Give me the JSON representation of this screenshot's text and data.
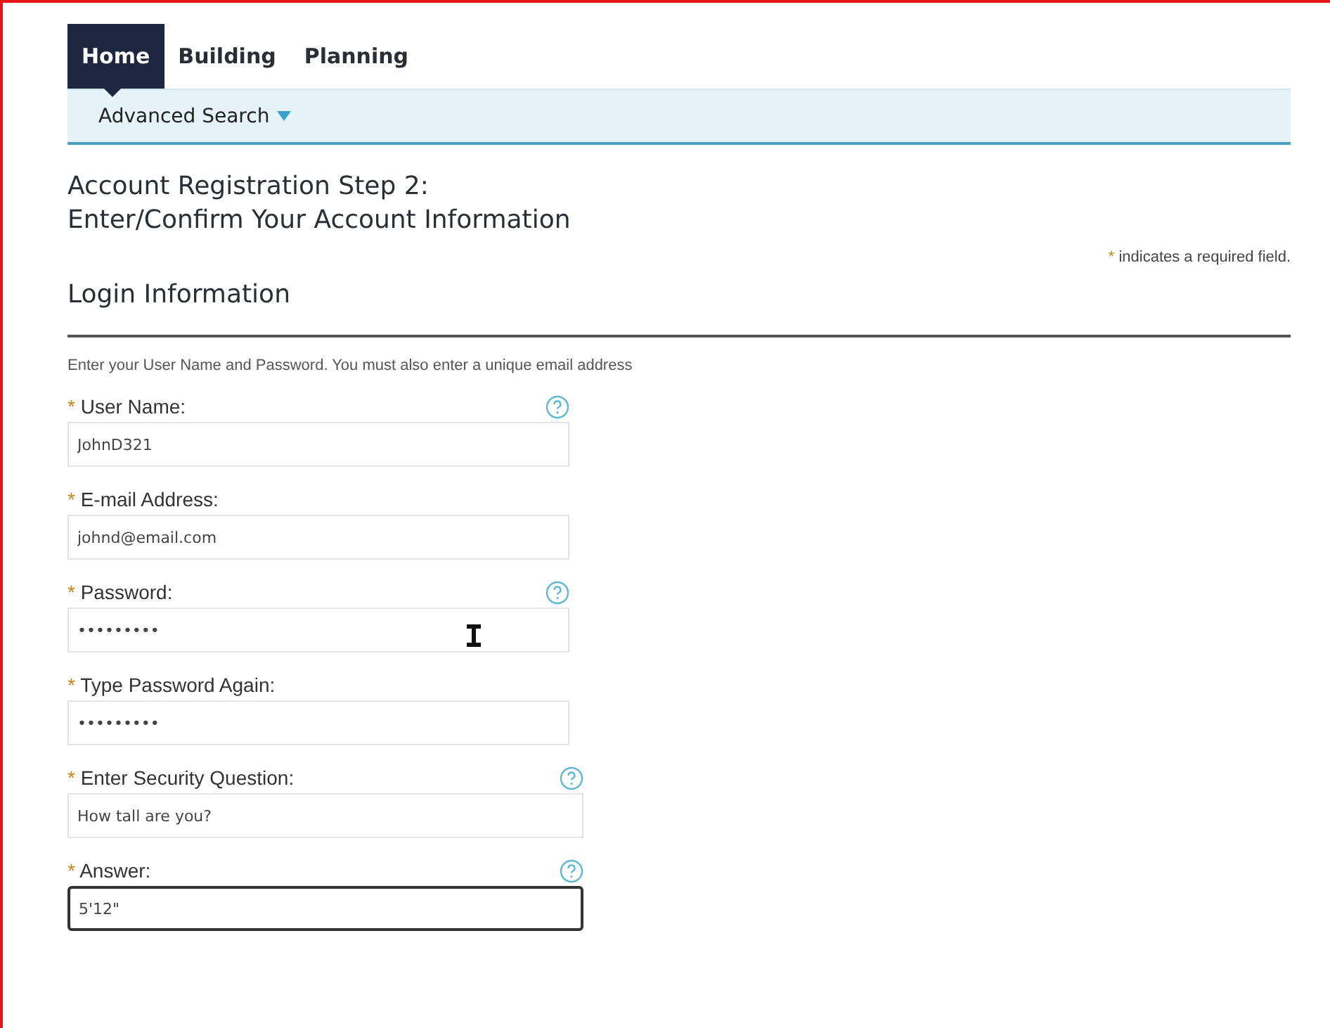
{
  "tabs": [
    {
      "label": "Home",
      "selected": true
    },
    {
      "label": "Building",
      "selected": false
    },
    {
      "label": "Planning",
      "selected": false
    }
  ],
  "subnav": {
    "label": "Advanced Search"
  },
  "heading": [
    "Account Registration Step 2:",
    "Enter/Confirm Your Account Information"
  ],
  "required_note": {
    "mark": "*",
    "text": "indicates a required field."
  },
  "section_title": "Login Information",
  "instructions": "Enter your User Name and Password.  You must also enter a unique email address",
  "fields": [
    {
      "label": "User Name:",
      "required": true,
      "help": true,
      "value": "JohnD321",
      "focused": false,
      "wide": false
    },
    {
      "label": "E-mail Address:",
      "required": true,
      "help": false,
      "value": "johnd@email.com",
      "focused": false,
      "wide": false
    },
    {
      "label": "Password:",
      "required": true,
      "help": true,
      "value": "•••••••••",
      "focused": false,
      "wide": false
    },
    {
      "label": "Type Password Again:",
      "required": true,
      "help": false,
      "value": "•••••••••",
      "focused": false,
      "wide": false
    },
    {
      "label": "Enter Security Question:",
      "required": true,
      "help": true,
      "value": "How tall are you?",
      "focused": false,
      "wide": true
    },
    {
      "label": "Answer:",
      "required": true,
      "help": true,
      "value": "5'12\"",
      "focused": true,
      "wide": true
    }
  ]
}
